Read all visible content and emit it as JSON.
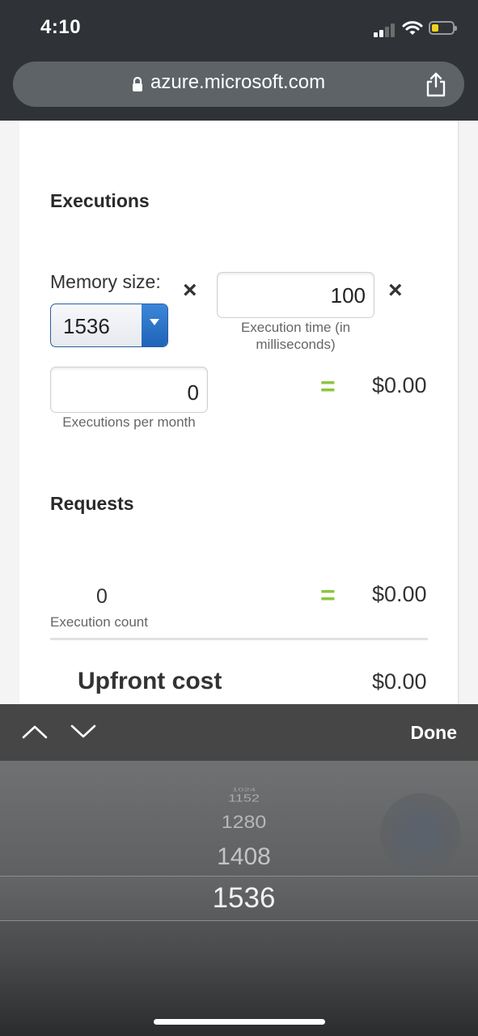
{
  "status_bar": {
    "time": "4:10"
  },
  "browser": {
    "url": "azure.microsoft.com"
  },
  "calculator": {
    "executions": {
      "heading": "Executions",
      "memory_label": "Memory size:",
      "memory_value": "1536",
      "multiply_symbol": "×",
      "execution_time_value": "100",
      "execution_time_caption": "Execution time (in milliseconds)",
      "executions_value": "0",
      "executions_caption": "Executions per month",
      "equals_symbol": "=",
      "cost": "$0.00"
    },
    "requests": {
      "heading": "Requests",
      "count_value": "0",
      "count_caption": "Execution count",
      "equals_symbol": "=",
      "cost": "$0.00"
    },
    "upfront": {
      "label": "Upfront cost",
      "cost": "$0.00"
    }
  },
  "keyboard_toolbar": {
    "done_label": "Done"
  },
  "picker": {
    "options": [
      "1024",
      "1152",
      "1280",
      "1408",
      "1536"
    ],
    "selected": "1536"
  },
  "colors": {
    "accent_green": "#8cc63f",
    "select_blue": "#1e64b8"
  }
}
